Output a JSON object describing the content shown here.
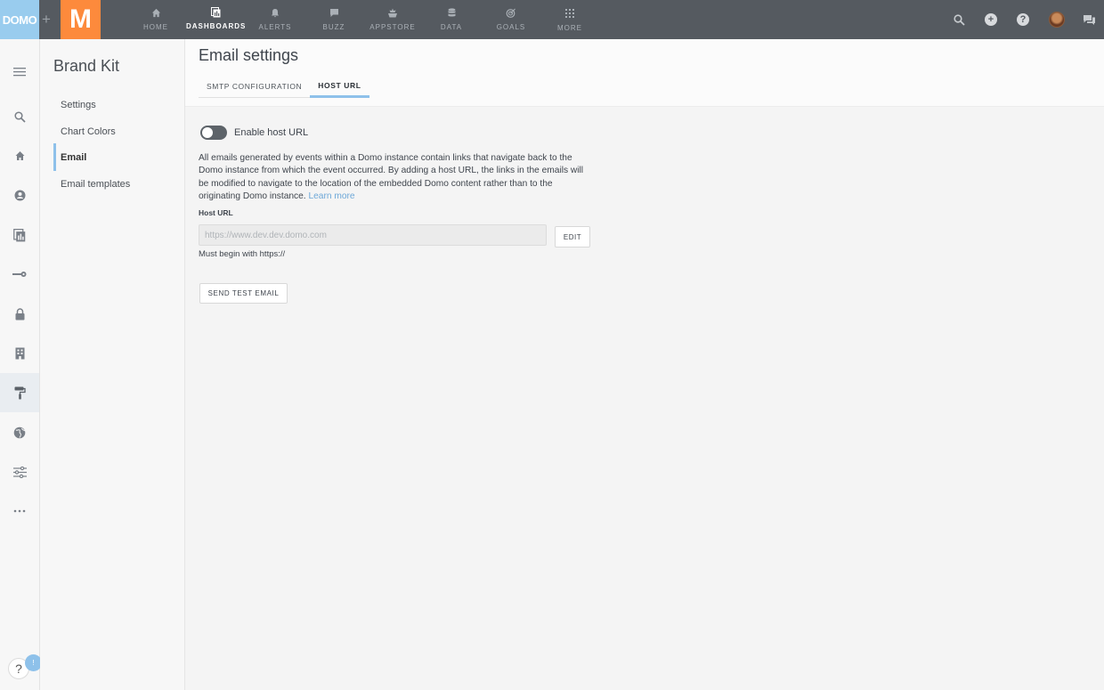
{
  "topbar": {
    "domo_logo": "DOMO",
    "plus": "+",
    "m_logo": "M",
    "nav": [
      {
        "label": "HOME",
        "icon": "home-icon"
      },
      {
        "label": "DASHBOARDS",
        "icon": "dashboards-icon",
        "active": true
      },
      {
        "label": "ALERTS",
        "icon": "bell-icon"
      },
      {
        "label": "BUZZ",
        "icon": "chat-icon"
      },
      {
        "label": "APPSTORE",
        "icon": "appstore-icon"
      },
      {
        "label": "DATA",
        "icon": "database-icon"
      },
      {
        "label": "GOALS",
        "icon": "goals-icon"
      },
      {
        "label": "MORE",
        "icon": "grid-icon"
      }
    ],
    "right_icons": [
      "search-icon",
      "add-icon",
      "help-icon",
      "avatar",
      "chat-icon"
    ]
  },
  "rail": {
    "items": [
      "menu-icon",
      "search-icon",
      "home-icon",
      "user-shield-icon",
      "reports-icon",
      "key-icon",
      "lock-icon",
      "building-icon",
      "paint-roller-icon",
      "globe-icon",
      "sliders-icon",
      "more-icon"
    ],
    "active": "paint-roller-icon",
    "help": "?",
    "badge": "!"
  },
  "sidebar": {
    "title": "Brand Kit",
    "items": [
      {
        "label": "Settings"
      },
      {
        "label": "Chart Colors"
      },
      {
        "label": "Email",
        "active": true
      },
      {
        "label": "Email templates"
      }
    ]
  },
  "header": {
    "title": "Email settings",
    "tabs": [
      {
        "label": "SMTP CONFIGURATION"
      },
      {
        "label": "HOST URL",
        "active": true
      }
    ]
  },
  "form": {
    "toggle_label": "Enable host URL",
    "toggle_on": false,
    "description": "All emails generated by events within a Domo instance contain links that navigate back to the Domo instance from which the event occurred. By adding a host URL, the links in the emails will be modified to navigate to the location of the embedded Domo content rather than to the originating Domo instance.",
    "learn_more": "Learn more",
    "field_label": "Host URL",
    "url_placeholder": "https://www.dev.dev.domo.com",
    "edit_label": "EDIT",
    "hint": "Must begin with https://",
    "send_test_label": "SEND TEST EMAIL"
  },
  "colors": {
    "topbar": "#555a60",
    "domo_blue": "#99ccee",
    "brand_orange": "#fd8a3c",
    "accent": "#8ec1ea",
    "link": "#6ea8d8"
  }
}
